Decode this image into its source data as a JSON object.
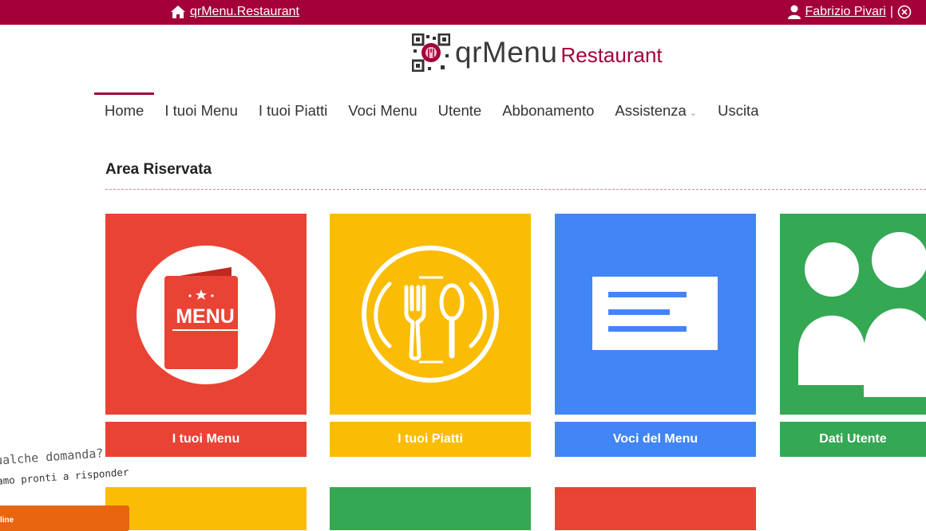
{
  "topbar": {
    "site_link": "qrMenu.Restaurant",
    "user_name": "Fabrizio Pivari",
    "separator": "|"
  },
  "logo": {
    "qr_text": "qrMenu",
    "restaurant_text": "Restaurant"
  },
  "nav": {
    "items": [
      {
        "label": "Home"
      },
      {
        "label": "I tuoi Menu"
      },
      {
        "label": "I tuoi Piatti"
      },
      {
        "label": "Voci Menu"
      },
      {
        "label": "Utente"
      },
      {
        "label": "Abbonamento"
      },
      {
        "label": "Assistenza"
      },
      {
        "label": "Uscita"
      }
    ]
  },
  "main": {
    "title": "Area Riservata",
    "tiles": [
      {
        "label": "I tuoi Menu",
        "icon": "menu-book-icon",
        "menu_text": "MENU"
      },
      {
        "label": "I tuoi Piatti",
        "icon": "cutlery-plate-icon"
      },
      {
        "label": "Voci del Menu",
        "icon": "text-lines-icon"
      },
      {
        "label": "Dati Utente",
        "icon": "users-icon"
      }
    ]
  },
  "chat": {
    "question": "ualche domanda?",
    "answer": "amo pronti a risponder",
    "button": "line"
  },
  "colors": {
    "brand": "#a3003a",
    "red": "#e94335",
    "yellow": "#fbbc05",
    "blue": "#4285f4",
    "green": "#34a853",
    "chat_orange": "#e8650f"
  }
}
